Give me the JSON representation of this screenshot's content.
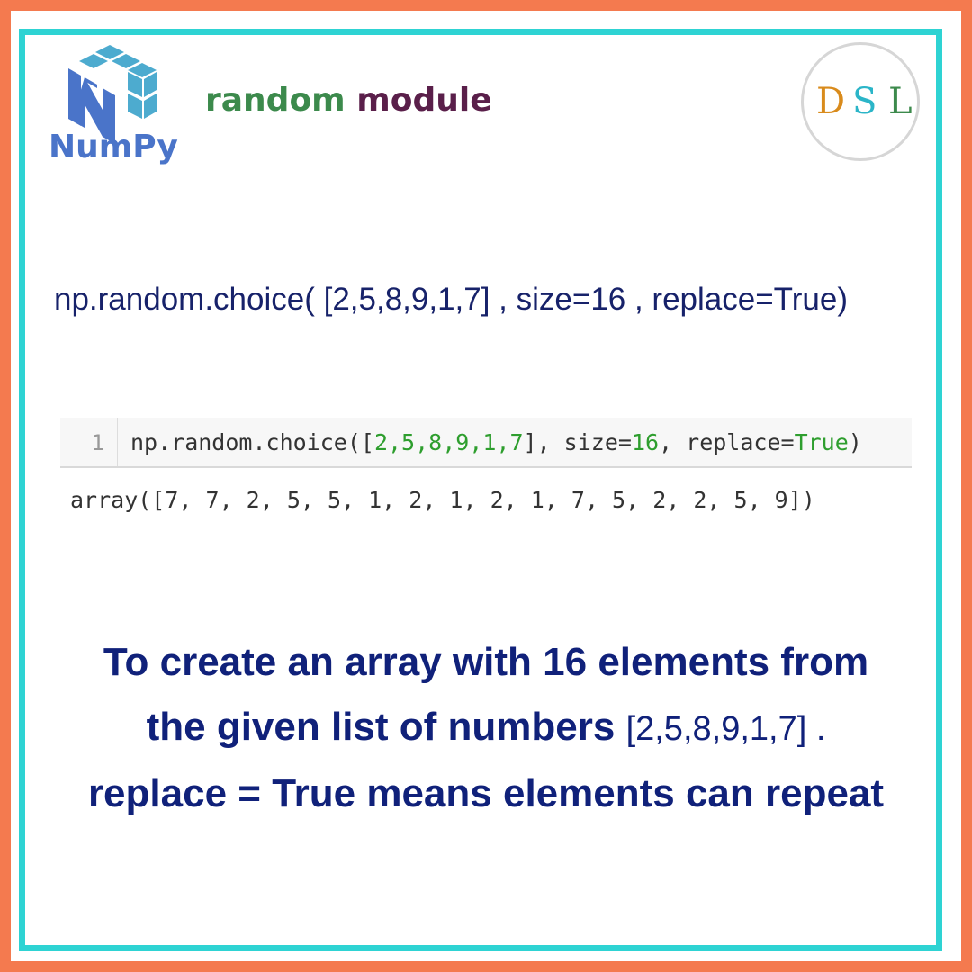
{
  "header": {
    "logo_text": "NumPy",
    "title_word1": "random",
    "title_word2": "module",
    "badge": {
      "letters": [
        "D",
        "S",
        "L"
      ],
      "colors": [
        "#d98b1c",
        "#2bb5c8",
        "#3c8a4c"
      ]
    }
  },
  "formula": "np.random.choice( [2,5,8,9,1,7] , size=16 , replace=True)",
  "code_cell": {
    "line_number": "1",
    "code_prefix": "np.random.choice([",
    "code_list": "2,5,8,9,1,7",
    "code_mid": "], size=",
    "code_size": "16",
    "code_mid2": ", replace=",
    "code_bool": "True",
    "code_suffix": ")",
    "output": "array([7, 7, 2, 5, 5, 1, 2, 1, 2, 1, 7, 5, 2, 2, 5, 9])"
  },
  "description": {
    "line1": "To create an array with 16 elements from",
    "line2_bold": "the given list of numbers ",
    "line2_normal": "[2,5,8,9,1,7] .",
    "line3": "replace = True means elements can repeat"
  },
  "colors": {
    "outer_border": "#f47a4f",
    "inner_border": "#2ed3d3",
    "text_primary": "#10217a"
  }
}
